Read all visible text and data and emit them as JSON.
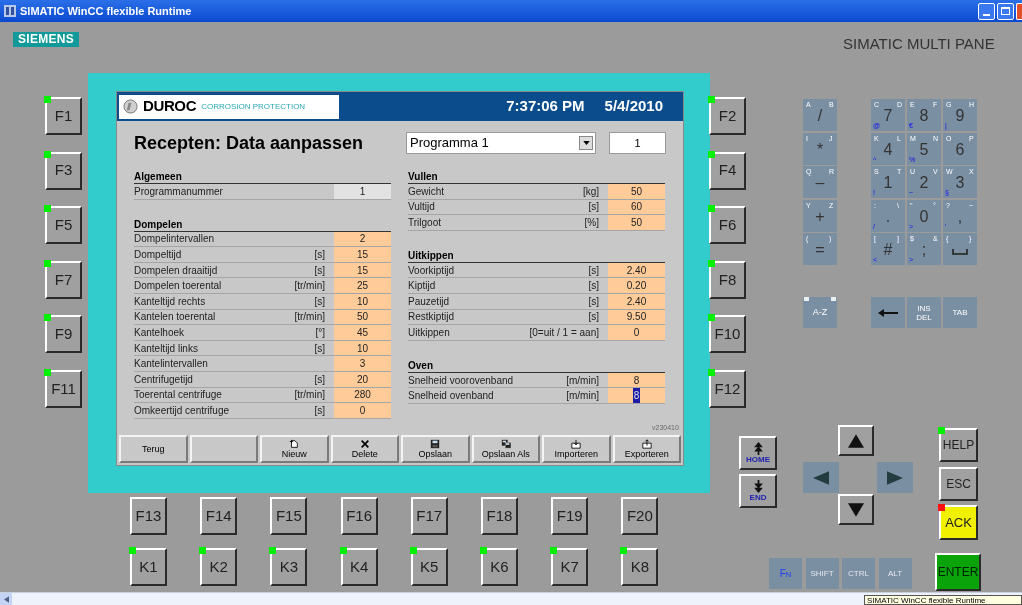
{
  "window": {
    "title": "SIMATIC WinCC flexible Runtime"
  },
  "brand": {
    "logo": "SIEMENS",
    "model": "SIMATIC MULTI PANE"
  },
  "screen": {
    "logo": "DUROC",
    "tagline": "CORROSION PROTECTION",
    "time": "7:37:06 PM",
    "date": "5/4/2010",
    "title": "Recepten: Data aanpassen",
    "program_select": {
      "value": "Programma 1"
    },
    "program_number": "1",
    "version": "v230410",
    "columns": [
      [
        {
          "heading": "Algemeen",
          "rows": [
            {
              "label": "Programmanummer",
              "value": "1",
              "kind": "display",
              "focused": false
            }
          ]
        },
        {
          "heading": "Dompelen",
          "rows": [
            {
              "label": "Dompelintervallen",
              "value": "2",
              "kind": "input",
              "focused": false
            },
            {
              "label": "Dompeltijd",
              "unit": "[s]",
              "value": "15",
              "kind": "input",
              "focused": false
            },
            {
              "label": "Dompelen draaitijd",
              "unit": "[s]",
              "value": "15",
              "kind": "input",
              "focused": false
            },
            {
              "label": "Dompelen toerental",
              "unit": "[tr/min]",
              "value": "25",
              "kind": "input",
              "focused": false
            },
            {
              "label": "Kanteltijd rechts",
              "unit": "[s]",
              "value": "10",
              "kind": "input",
              "focused": false
            },
            {
              "label": "Kantelen toerental",
              "unit": "[tr/min]",
              "value": "50",
              "kind": "input",
              "focused": false
            },
            {
              "label": "Kantelhoek",
              "unit": "[°]",
              "value": "45",
              "kind": "input",
              "focused": false
            },
            {
              "label": "Kanteltijd links",
              "unit": "[s]",
              "value": "10",
              "kind": "input",
              "focused": false
            },
            {
              "label": "Kantelintervallen",
              "value": "3",
              "kind": "input",
              "focused": false
            },
            {
              "label": "Centrifugetijd",
              "unit": "[s]",
              "value": "20",
              "kind": "input",
              "focused": false
            },
            {
              "label": "Toerental centrifuge",
              "unit": "[tr/min]",
              "value": "280",
              "kind": "input",
              "focused": false
            },
            {
              "label": "Omkeertijd centrifuge",
              "unit": "[s]",
              "value": "0",
              "kind": "input",
              "focused": false
            }
          ]
        }
      ],
      [
        {
          "heading": "Vullen",
          "rows": [
            {
              "label": "Gewicht",
              "unit": "[kg]",
              "value": "50",
              "kind": "input",
              "focused": false
            },
            {
              "label": "Vultijd",
              "unit": "[s]",
              "value": "60",
              "kind": "input",
              "focused": false
            },
            {
              "label": "Trilgoot",
              "unit": "[%]",
              "value": "50",
              "kind": "input",
              "focused": false
            }
          ]
        },
        {
          "heading": "Uitkippen",
          "rows": [
            {
              "label": "Voorkiptijd",
              "unit": "[s]",
              "value": "2.40",
              "kind": "input",
              "focused": false
            },
            {
              "label": "Kiptijd",
              "unit": "[s]",
              "value": "0.20",
              "kind": "input",
              "focused": false
            },
            {
              "label": "Pauzetijd",
              "unit": "[s]",
              "value": "2.40",
              "kind": "input",
              "focused": false
            },
            {
              "label": "Restkiptijd",
              "unit": "[s]",
              "value": "9.50",
              "kind": "input",
              "focused": false
            },
            {
              "label": "Uitkippen",
              "unit": "[0=uit / 1 = aan]",
              "value": "0",
              "kind": "input",
              "focused": false
            }
          ]
        },
        {
          "heading": "Oven",
          "rows": [
            {
              "label": "Snelheid voorovenband",
              "unit": "[m/min]",
              "value": "8",
              "kind": "input",
              "focused": false
            },
            {
              "label": "Snelheid ovenband",
              "unit": "[m/min]",
              "value": "8",
              "kind": "input",
              "focused": true
            }
          ]
        }
      ]
    ],
    "buttons": [
      {
        "label": "Terug",
        "kind": "plain"
      },
      {
        "kind": "blank"
      },
      {
        "label": "Nieuw",
        "kind": "new"
      },
      {
        "label": "Delete",
        "kind": "delete"
      },
      {
        "label": "Opslaan",
        "kind": "save"
      },
      {
        "label": "Opslaan Als",
        "kind": "save_as"
      },
      {
        "label": "Importeren",
        "kind": "import"
      },
      {
        "label": "Exporteren",
        "kind": "export"
      }
    ]
  },
  "left_keys": [
    {
      "label": "F1",
      "led": true
    },
    {
      "label": "F3",
      "led": true
    },
    {
      "label": "F5",
      "led": true
    },
    {
      "label": "F7",
      "led": true
    },
    {
      "label": "F9",
      "led": true
    },
    {
      "label": "F11",
      "led": true
    }
  ],
  "right_keys": [
    {
      "label": "F2",
      "led": true
    },
    {
      "label": "F4",
      "led": true
    },
    {
      "label": "F6",
      "led": true
    },
    {
      "label": "F8",
      "led": true
    },
    {
      "label": "F10",
      "led": true
    },
    {
      "label": "F12",
      "led": true
    }
  ],
  "bottom_keys": [
    {
      "label": "F13",
      "led": false
    },
    {
      "label": "F14",
      "led": false
    },
    {
      "label": "F15",
      "led": false
    },
    {
      "label": "F16",
      "led": false
    },
    {
      "label": "F17",
      "led": false
    },
    {
      "label": "F18",
      "led": false
    },
    {
      "label": "F19",
      "led": false
    },
    {
      "label": "F20",
      "led": false
    }
  ],
  "k_keys": [
    {
      "label": "K1",
      "led": true
    },
    {
      "label": "K2",
      "led": true
    },
    {
      "label": "K3",
      "led": true
    },
    {
      "label": "K4",
      "led": true
    },
    {
      "label": "K5",
      "led": true
    },
    {
      "label": "K6",
      "led": true
    },
    {
      "label": "K7",
      "led": true
    },
    {
      "label": "K8",
      "led": true
    }
  ],
  "keypad_left": [
    {
      "main": "/",
      "top_left": "A",
      "top_right": "B"
    },
    {
      "main": "*",
      "top_left": "I",
      "top_right": "J"
    },
    {
      "main": "–",
      "top_left": "Q",
      "top_right": "R"
    },
    {
      "main": "+",
      "top_left": "Y",
      "top_right": "Z"
    },
    {
      "main": "=",
      "top_left": "(",
      "top_right": ")"
    }
  ],
  "keypad_grid": [
    {
      "main": "7",
      "top_left": "C",
      "top_right": "D",
      "alt": "@"
    },
    {
      "main": "8",
      "top_left": "E",
      "top_right": "F",
      "alt": "€"
    },
    {
      "main": "9",
      "top_left": "G",
      "top_right": "H",
      "alt": "|"
    },
    {
      "main": "4",
      "top_left": "K",
      "top_right": "L",
      "alt": "^"
    },
    {
      "main": "5",
      "top_left": "M",
      "top_right": "N",
      "alt": "%"
    },
    {
      "main": "6",
      "top_left": "O",
      "top_right": "P"
    },
    {
      "main": "1",
      "top_left": "S",
      "top_right": "T",
      "alt": "!"
    },
    {
      "main": "2",
      "top_left": "U",
      "top_right": "V",
      "alt": "~"
    },
    {
      "main": "3",
      "top_left": "W",
      "top_right": "X",
      "alt": "§"
    },
    {
      "main": ".",
      "top_left": ":",
      "top_right": "\\",
      "alt": "/"
    },
    {
      "main": "0",
      "top_left": "\"",
      "top_right": "°",
      "alt": ">"
    },
    {
      "main": ",",
      "top_left": "?",
      "top_right": "~",
      "alt": "'"
    },
    {
      "main": "#",
      "top_left": "[",
      "top_right": "]",
      "alt": "<"
    },
    {
      "main": ";",
      "top_left": "$",
      "top_right": "&",
      "alt": ">"
    },
    {
      "kind": "space",
      "top_left": "{",
      "top_right": "}"
    }
  ],
  "edit_keys": [
    {
      "kind": "shift_lock",
      "label": "A-Z"
    },
    {
      "kind": "backspace"
    },
    {
      "kind": "text",
      "label": "INS DEL"
    },
    {
      "kind": "text",
      "label": "TAB"
    }
  ],
  "nav_keys": [
    {
      "kind": "home",
      "label": "HOME"
    },
    {
      "kind": "end",
      "label": "END"
    }
  ],
  "system_keys": [
    {
      "label": "HELP",
      "kind": "gray",
      "led": true,
      "color": "#00f000"
    },
    {
      "label": "ESC",
      "kind": "gray",
      "led": false
    },
    {
      "label": "ACK",
      "kind": "yellow",
      "led": true,
      "color": "#ff1010"
    },
    {
      "label": "ENTER",
      "kind": "green",
      "led": false
    }
  ],
  "modifier_keys": [
    {
      "label": "F$_{N}$",
      "kind": "fn"
    },
    {
      "label": "SHIFT",
      "kind": "plain"
    },
    {
      "label": "CTRL",
      "kind": "plain"
    },
    {
      "label": "ALT",
      "kind": "plain"
    }
  ],
  "tooltip": "SIMATIC WinCC flexible Runtime"
}
